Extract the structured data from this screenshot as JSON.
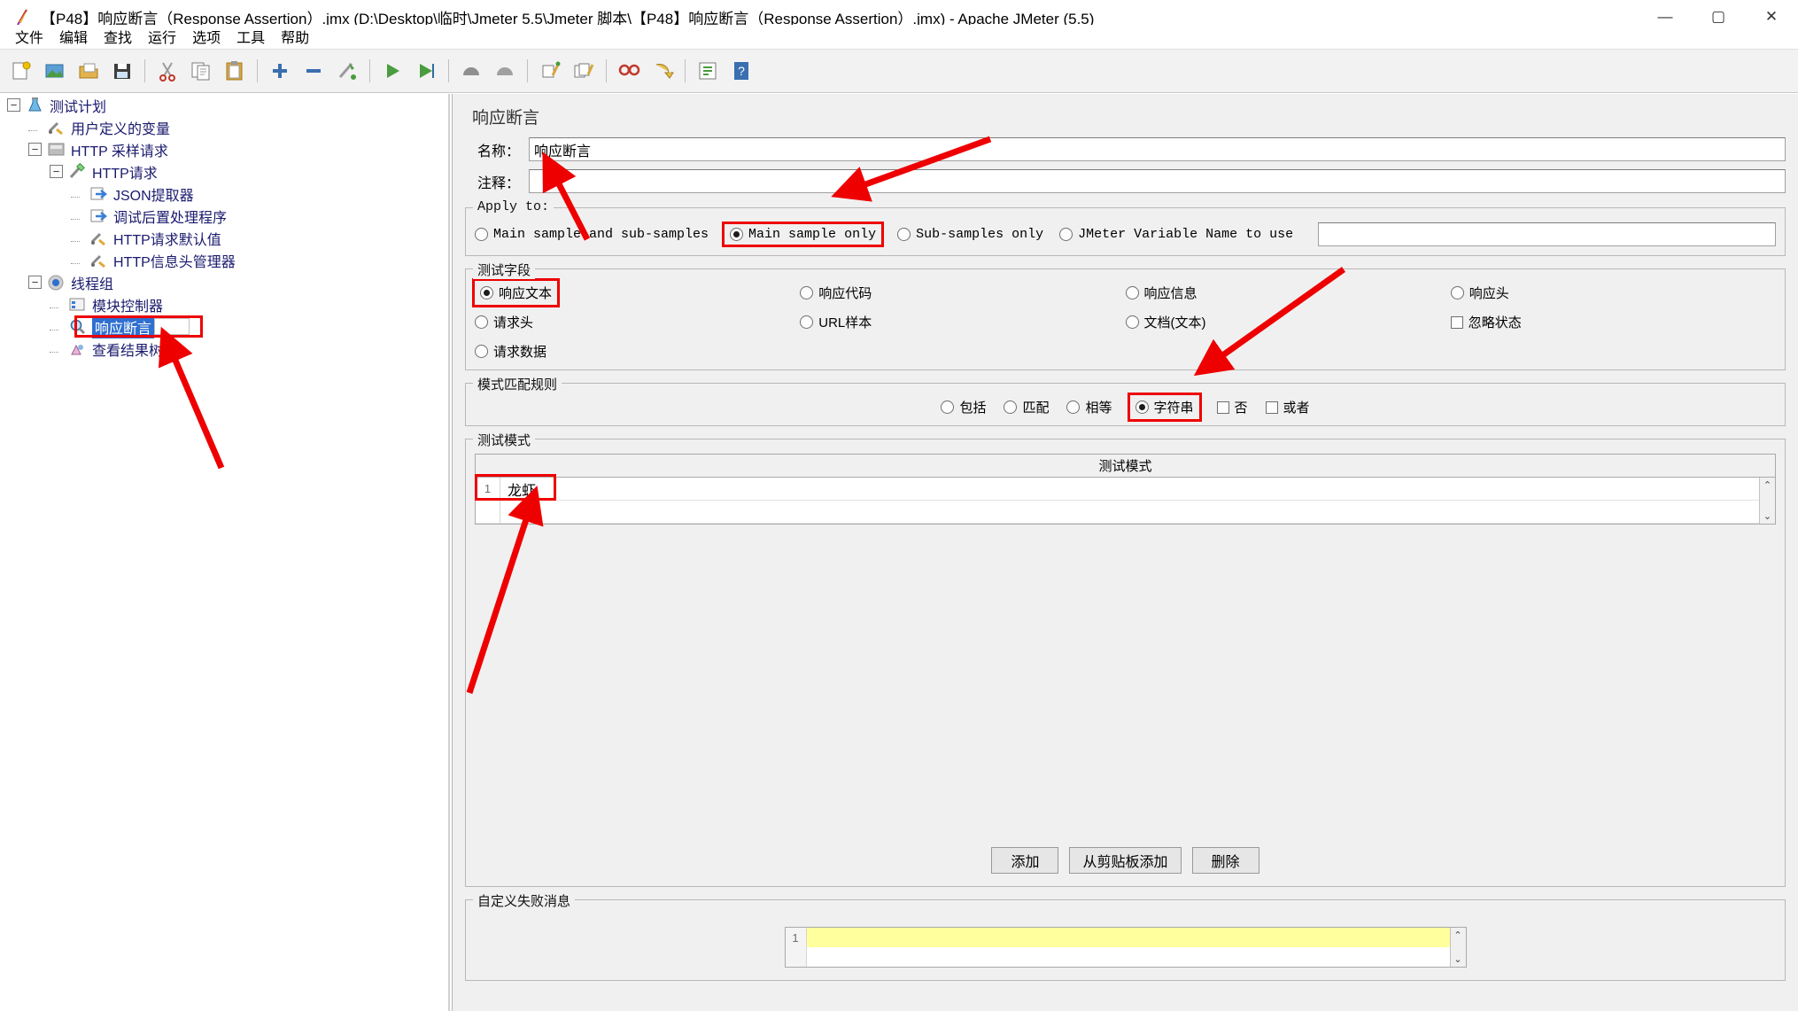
{
  "window": {
    "title": "【P48】响应断言（Response Assertion）.jmx (D:\\Desktop\\临时\\Jmeter 5.5\\Jmeter 脚本\\【P48】响应断言（Response Assertion）.jmx) - Apache JMeter (5.5)",
    "app_icon": "jmeter-feather-icon",
    "minimize": "—",
    "maximize": "▢",
    "close": "✕"
  },
  "menubar": {
    "items": [
      {
        "label": "文件",
        "name": "menu-file"
      },
      {
        "label": "编辑",
        "name": "menu-edit"
      },
      {
        "label": "查找",
        "name": "menu-search"
      },
      {
        "label": "运行",
        "name": "menu-run"
      },
      {
        "label": "选项",
        "name": "menu-options"
      },
      {
        "label": "工具",
        "name": "menu-tools"
      },
      {
        "label": "帮助",
        "name": "menu-help"
      }
    ]
  },
  "toolbar": {
    "buttons": [
      {
        "name": "new-icon",
        "title": "新建"
      },
      {
        "name": "templates-icon",
        "title": "模板"
      },
      {
        "name": "open-icon",
        "title": "打开"
      },
      {
        "name": "save-icon",
        "title": "保存"
      },
      {
        "name": "cut-icon",
        "title": "剪切"
      },
      {
        "name": "copy-icon",
        "title": "复制"
      },
      {
        "name": "paste-icon",
        "title": "粘贴"
      },
      {
        "name": "expand-all-icon",
        "title": "展开全部"
      },
      {
        "name": "collapse-all-icon",
        "title": "折叠全部"
      },
      {
        "name": "toggle-icon",
        "title": "切换"
      },
      {
        "name": "start-icon",
        "title": "启动"
      },
      {
        "name": "start-no-pause-icon",
        "title": "无暂停启动"
      },
      {
        "name": "stop-icon",
        "title": "停止"
      },
      {
        "name": "shutdown-icon",
        "title": "关闭"
      },
      {
        "name": "clear-icon",
        "title": "清除"
      },
      {
        "name": "clear-all-icon",
        "title": "清除全部"
      },
      {
        "name": "search-icon",
        "title": "查找"
      },
      {
        "name": "search-reset-icon",
        "title": "重置查找"
      },
      {
        "name": "function-helper-icon",
        "title": "函数助手对话框"
      },
      {
        "name": "help-icon",
        "title": "帮助"
      }
    ]
  },
  "tree": {
    "nodes": [
      {
        "label": "测试计划",
        "icon": "test-plan-icon",
        "depth": 0,
        "toggle": "minus",
        "selected": false
      },
      {
        "label": "用户定义的变量",
        "icon": "user-variables-icon",
        "depth": 1,
        "toggle": "none",
        "selected": false
      },
      {
        "label": "HTTP 采样请求",
        "icon": "http-sampler-icon",
        "depth": 1,
        "toggle": "minus",
        "selected": false
      },
      {
        "label": "HTTP请求",
        "icon": "http-request-icon",
        "depth": 2,
        "toggle": "minus",
        "selected": false
      },
      {
        "label": "JSON提取器",
        "icon": "json-extractor-icon",
        "depth": 3,
        "toggle": "none",
        "selected": false
      },
      {
        "label": "调试后置处理程序",
        "icon": "debug-postprocessor-icon",
        "depth": 3,
        "toggle": "none",
        "selected": false
      },
      {
        "label": "HTTP请求默认值",
        "icon": "http-defaults-icon",
        "depth": 3,
        "toggle": "none",
        "selected": false
      },
      {
        "label": "HTTP信息头管理器",
        "icon": "http-header-manager-icon",
        "depth": 3,
        "toggle": "none",
        "selected": false
      },
      {
        "label": "线程组",
        "icon": "thread-group-icon",
        "depth": 1,
        "toggle": "minus",
        "selected": false
      },
      {
        "label": "模块控制器",
        "icon": "module-controller-icon",
        "depth": 2,
        "toggle": "none",
        "selected": false
      },
      {
        "label": "响应断言",
        "icon": "response-assertion-icon",
        "depth": 2,
        "toggle": "none",
        "selected": true
      },
      {
        "label": "查看结果树",
        "icon": "view-results-tree-icon",
        "depth": 2,
        "toggle": "none",
        "selected": false
      }
    ]
  },
  "panel": {
    "title": "响应断言",
    "name_label": "名称：",
    "name_value": "响应断言",
    "comment_label": "注释：",
    "comment_value": "",
    "apply_to": {
      "legend": "Apply to:",
      "options": [
        {
          "label": "Main sample and sub-samples",
          "checked": false,
          "highlight": false
        },
        {
          "label": "Main sample only",
          "checked": true,
          "highlight": true
        },
        {
          "label": "Sub-samples only",
          "checked": false,
          "highlight": false
        },
        {
          "label": "JMeter Variable Name to use",
          "checked": false,
          "highlight": false
        }
      ],
      "variable_value": ""
    },
    "test_field": {
      "legend": "测试字段",
      "options": [
        {
          "label": "响应文本",
          "type": "radio",
          "checked": true,
          "highlight": true
        },
        {
          "label": "响应代码",
          "type": "radio",
          "checked": false,
          "highlight": false
        },
        {
          "label": "响应信息",
          "type": "radio",
          "checked": false,
          "highlight": false
        },
        {
          "label": "响应头",
          "type": "radio",
          "checked": false,
          "highlight": false
        },
        {
          "label": "请求头",
          "type": "radio",
          "checked": false,
          "highlight": false
        },
        {
          "label": "URL样本",
          "type": "radio",
          "checked": false,
          "highlight": false
        },
        {
          "label": "文档(文本)",
          "type": "radio",
          "checked": false,
          "highlight": false
        },
        {
          "label": "忽略状态",
          "type": "checkbox",
          "checked": false,
          "highlight": false
        },
        {
          "label": "请求数据",
          "type": "radio",
          "checked": false,
          "highlight": false
        }
      ]
    },
    "pattern_rules": {
      "legend": "模式匹配规则",
      "options": [
        {
          "label": "包括",
          "type": "radio",
          "checked": false,
          "highlight": false
        },
        {
          "label": "匹配",
          "type": "radio",
          "checked": false,
          "highlight": false
        },
        {
          "label": "相等",
          "type": "radio",
          "checked": false,
          "highlight": false
        },
        {
          "label": "字符串",
          "type": "radio",
          "checked": true,
          "highlight": true
        },
        {
          "label": "否",
          "type": "checkbox",
          "checked": false,
          "highlight": false
        },
        {
          "label": "或者",
          "type": "checkbox",
          "checked": false,
          "highlight": false
        }
      ]
    },
    "test_patterns": {
      "legend": "测试模式",
      "column_header": "测试模式",
      "rows": [
        {
          "num": "1",
          "value": "龙虾",
          "highlight": true
        },
        {
          "num": "",
          "value": "",
          "highlight": false
        }
      ],
      "scroll_up": "⌃",
      "scroll_down": "⌄"
    },
    "pattern_buttons": [
      {
        "label": "添加",
        "name": "add-pattern-button"
      },
      {
        "label": "从剪贴板添加",
        "name": "add-from-clipboard-button"
      },
      {
        "label": "删除",
        "name": "delete-pattern-button"
      }
    ],
    "failure_message": {
      "legend": "自定义失败消息",
      "line_number": "1",
      "value": "",
      "scroll_up": "⌃",
      "scroll_down": "⌄"
    }
  },
  "annotations": {
    "arrow_color": "#ee0000",
    "count": 4
  }
}
